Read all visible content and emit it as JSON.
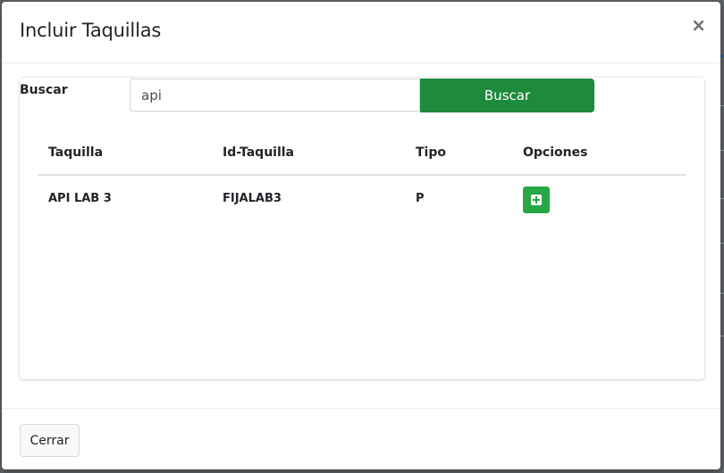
{
  "modal": {
    "title": "Incluir Taquillas",
    "close_symbol": "×"
  },
  "search": {
    "label": "Buscar",
    "input_value": "api",
    "button_label": "Buscar"
  },
  "table": {
    "headers": [
      "Taquilla",
      "Id-Taquilla",
      "Tipo",
      "Opciones"
    ],
    "rows": [
      {
        "taquilla": "API LAB 3",
        "id_taquilla": "FIJALAB3",
        "tipo": "P",
        "option_icon": "plus-square-icon"
      }
    ]
  },
  "footer": {
    "close_label": "Cerrar"
  },
  "colors": {
    "primary_button": "#1e8a3c",
    "add_button": "#28a745"
  }
}
